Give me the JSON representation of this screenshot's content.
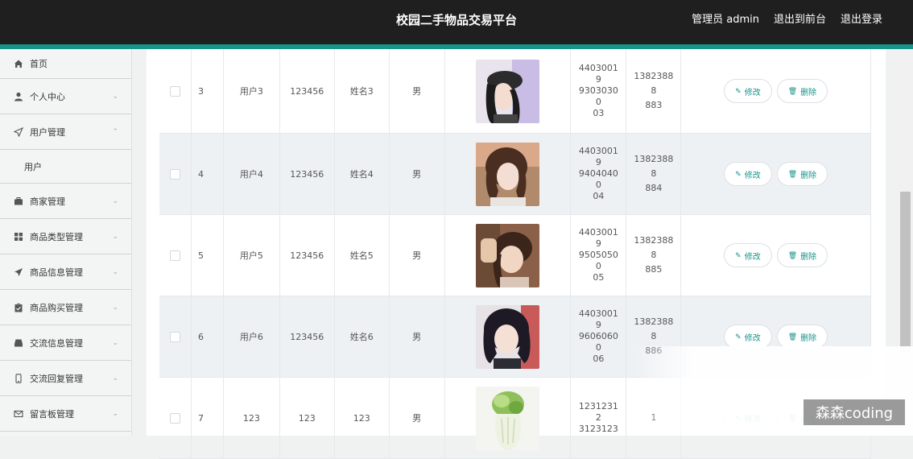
{
  "header": {
    "title": "校园二手物品交易平台",
    "admin_label": "管理员 admin",
    "front_link": "退出到前台",
    "logout_link": "退出登录"
  },
  "sidebar": {
    "items": [
      {
        "label": "首页",
        "icon": "home-icon"
      },
      {
        "label": "个人中心",
        "icon": "user-icon"
      },
      {
        "label": "用户管理",
        "icon": "send-icon"
      },
      {
        "label": "商家管理",
        "icon": "briefcase-icon"
      },
      {
        "label": "商品类型管理",
        "icon": "grid-icon"
      },
      {
        "label": "商品信息管理",
        "icon": "plane-icon"
      },
      {
        "label": "商品购买管理",
        "icon": "clipboard-icon"
      },
      {
        "label": "交流信息管理",
        "icon": "tray-icon"
      },
      {
        "label": "交流回复管理",
        "icon": "phone-icon"
      },
      {
        "label": "留言板管理",
        "icon": "mail-icon"
      }
    ],
    "sub_items": [
      {
        "label": "用户"
      }
    ]
  },
  "table": {
    "rows": [
      {
        "index": "3",
        "account": "用户3",
        "password": "123456",
        "name": "姓名3",
        "sex": "男",
        "id_card": "44030019930303000 3",
        "id_lines": [
          "44030019",
          "93030300",
          "03"
        ],
        "phone_lines": [
          "13823888",
          "883"
        ]
      },
      {
        "index": "4",
        "account": "用户4",
        "password": "123456",
        "name": "姓名4",
        "sex": "男",
        "id_lines": [
          "44030019",
          "94040400",
          "04"
        ],
        "phone_lines": [
          "13823888",
          "884"
        ]
      },
      {
        "index": "5",
        "account": "用户5",
        "password": "123456",
        "name": "姓名5",
        "sex": "男",
        "id_lines": [
          "44030019",
          "95050500",
          "05"
        ],
        "phone_lines": [
          "13823888",
          "885"
        ]
      },
      {
        "index": "6",
        "account": "用户6",
        "password": "123456",
        "name": "姓名6",
        "sex": "男",
        "id_lines": [
          "44030019",
          "96060600",
          "06"
        ],
        "phone_lines": [
          "13823888",
          "886"
        ]
      },
      {
        "index": "7",
        "account": "123",
        "password": "123",
        "name": "123",
        "sex": "男",
        "id_lines": [
          "12312312",
          "3123123"
        ],
        "phone_lines": [
          "1"
        ]
      }
    ],
    "edit_label": "修改",
    "delete_label": "删除"
  },
  "watermark": "森森coding",
  "colors": {
    "accent": "#17938a",
    "topbar": "#1e1f1e"
  }
}
